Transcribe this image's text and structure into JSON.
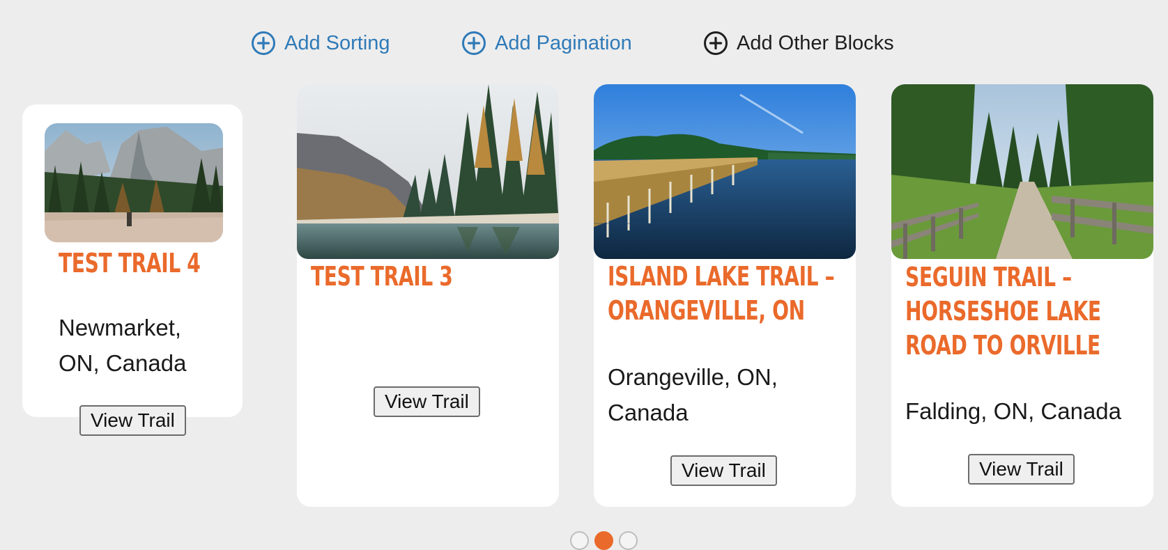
{
  "toolbar": {
    "add_sorting": "Add Sorting",
    "add_pagination": "Add Pagination",
    "add_other_blocks": "Add Other Blocks",
    "link_color": "#2f7ab8"
  },
  "colors": {
    "accent": "#ea6a2b",
    "background": "#ededed",
    "card": "#ffffff"
  },
  "cards": [
    {
      "title_lines": [
        "TEST TRAIL 4"
      ],
      "location_lines": [
        "Newmarket,",
        "ON, Canada"
      ],
      "button": "View Trail",
      "image": "mountain-meadow-photo"
    },
    {
      "title_lines": [
        "TEST TRAIL 3"
      ],
      "location_lines": [],
      "button": "View Trail",
      "image": "mountain-lake-forest-photo"
    },
    {
      "title_lines": [
        "ISLAND LAKE TRAIL –",
        "ORANGEVILLE, ON"
      ],
      "location_lines": [
        "Orangeville, ON,",
        "Canada"
      ],
      "button": "View Trail",
      "image": "lake-boardwalk-photo"
    },
    {
      "title_lines": [
        "SEGUIN TRAIL –",
        "HORSESHOE LAKE",
        "ROAD TO ORVILLE"
      ],
      "location_lines": [
        "Falding, ON, Canada"
      ],
      "button": "View Trail",
      "image": "forest-trail-bridge-photo"
    }
  ],
  "pagination": {
    "pages": 3,
    "active_page": 2
  }
}
